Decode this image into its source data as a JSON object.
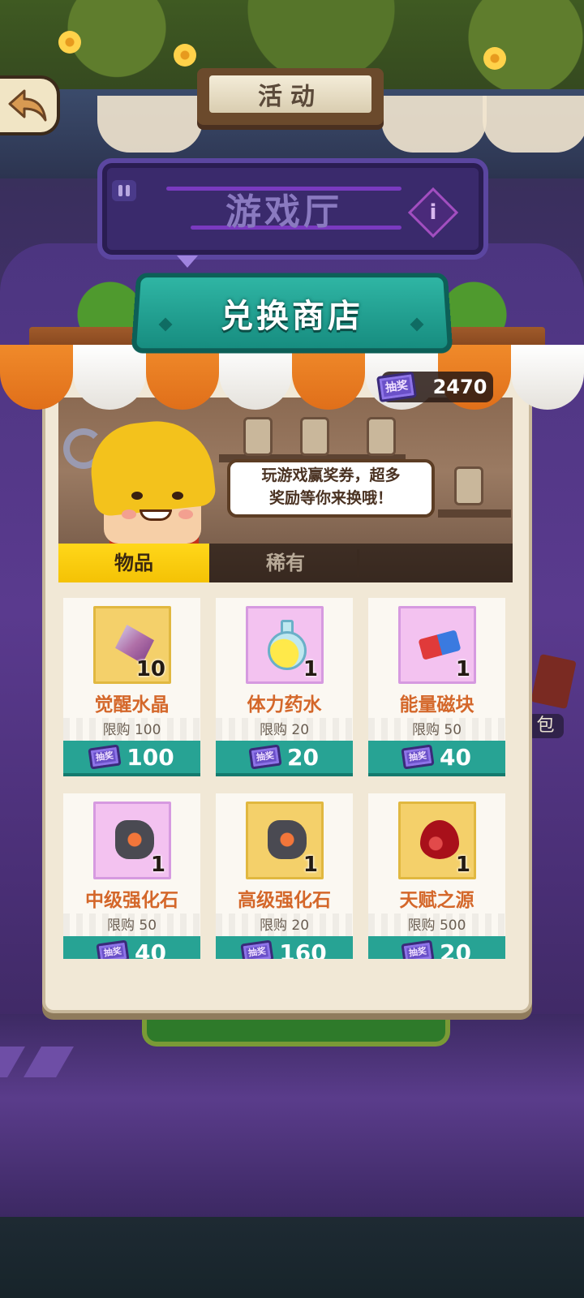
{
  "top_bar": {
    "activity_label": "活动"
  },
  "hall": {
    "title": "游戏厅"
  },
  "shop": {
    "title": "兑换商店",
    "ticket_label": "抽奖",
    "ticket_count": "2470",
    "speech": "玩游戏赢奖券，超多\n奖励等你来换哦！",
    "tabs": [
      {
        "label": "物品",
        "active": true
      },
      {
        "label": "稀有",
        "active": false
      }
    ],
    "items": [
      {
        "name": "觉醒水晶",
        "qty": "10",
        "limit": "限购 100",
        "price": "100",
        "frame": "gold",
        "icon": "crystal-icon"
      },
      {
        "name": "体力药水",
        "qty": "1",
        "limit": "限购 20",
        "price": "20",
        "frame": "pink",
        "icon": "potion-icon"
      },
      {
        "name": "能量磁块",
        "qty": "1",
        "limit": "限购 50",
        "price": "40",
        "frame": "pink",
        "icon": "magnet-icon"
      },
      {
        "name": "中级强化石",
        "qty": "1",
        "limit": "限购 50",
        "price": "40",
        "frame": "pink",
        "icon": "stone-icon"
      },
      {
        "name": "高级强化石",
        "qty": "1",
        "limit": "限购 20",
        "price": "160",
        "frame": "gold",
        "icon": "stone-icon"
      },
      {
        "name": "天赋之源",
        "qty": "1",
        "limit": "限购 500",
        "price": "20",
        "frame": "gold",
        "icon": "drop-icon"
      }
    ]
  },
  "side": {
    "badge_text": "包"
  },
  "colors": {
    "accent_teal": "#27a394",
    "tab_yellow": "#ffd71a",
    "item_name": "#d4672a",
    "ticket_purple": "#6a50c8"
  }
}
